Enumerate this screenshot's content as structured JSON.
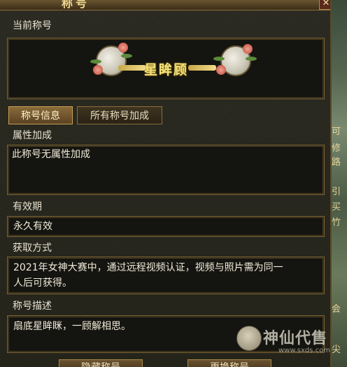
{
  "window": {
    "title": "称号",
    "close_glyph": "✕"
  },
  "current_title": {
    "label": "当前称号",
    "name": "星眸顾"
  },
  "tabs": [
    {
      "label": "称号信息",
      "active": true
    },
    {
      "label": "所有称号加成",
      "active": false
    }
  ],
  "attributes": {
    "label": "属性加成",
    "text": "此称号无属性加成"
  },
  "validity": {
    "label": "有效期",
    "text": "永久有效"
  },
  "acquire": {
    "label": "获取方式",
    "line1": "2021年女神大赛中，通过远程视频认证，视频与照片需为同一",
    "line2": "人后可获得。"
  },
  "description": {
    "label": "称号描述",
    "text": "扇底星眸眯，一顾解相思。"
  },
  "buttons": {
    "hide": "隐藏称号",
    "change": "更换称号"
  },
  "watermark": {
    "text": "神仙代售",
    "url": "www.sxds.com"
  },
  "scene_tags": [
    "可",
    "修",
    "路",
    "引",
    "买",
    "竹",
    "会",
    "尖"
  ],
  "colors": {
    "accent_gold": "#f4e27a",
    "frame_border": "#7a6436",
    "tab_active": "#8a6a3a"
  }
}
